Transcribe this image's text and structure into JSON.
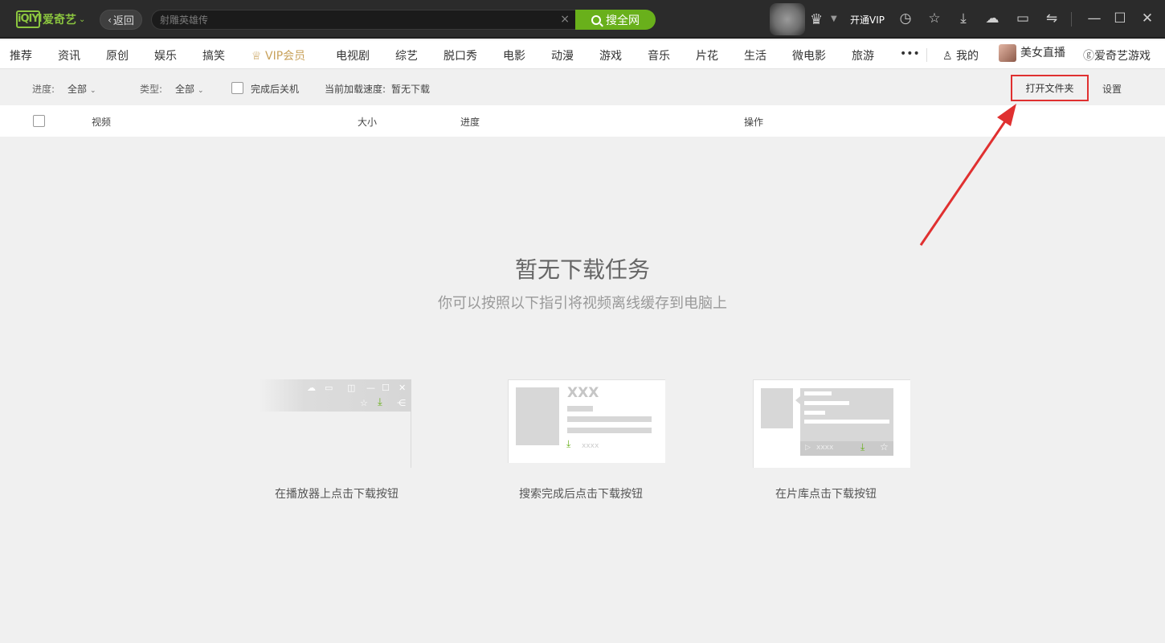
{
  "titlebar": {
    "logo_box": "iQIYI",
    "logo_text": "爱奇艺",
    "back_label": "返回",
    "search_placeholder": "射雕英雄传",
    "search_button": "搜全网",
    "vip_open": "开通VIP",
    "icons": [
      "crown-icon",
      "history-icon",
      "star-icon",
      "download-icon",
      "cloud-icon",
      "message-icon",
      "switch-icon",
      "minimize-icon",
      "maximize-icon",
      "close-icon"
    ]
  },
  "nav": {
    "items": [
      "推荐",
      "资讯",
      "原创",
      "娱乐",
      "搞笑",
      "VIP会员",
      "电视剧",
      "综艺",
      "脱口秀",
      "电影",
      "动漫",
      "游戏",
      "音乐",
      "片花",
      "生活",
      "微电影",
      "旅游"
    ],
    "more": "•••",
    "mine": "我的",
    "live": "美女直播",
    "games": "爱奇艺游戏"
  },
  "filter": {
    "progress_label": "进度:",
    "progress_value": "全部",
    "type_label": "类型:",
    "type_value": "全部",
    "shutdown_label": "完成后关机",
    "speed_label": "当前加载速度:",
    "speed_value": "暂无下载",
    "open_folder": "打开文件夹",
    "settings": "设置"
  },
  "table": {
    "headers": [
      "视频",
      "大小",
      "进度",
      "操作"
    ]
  },
  "empty": {
    "title": "暂无下载任务",
    "subtitle": "你可以按照以下指引将视频离线缓存到电脑上",
    "guides": [
      {
        "caption": "在播放器上点击下载按钮"
      },
      {
        "caption": "搜索完成后点击下载按钮",
        "placeholder": "XXX",
        "small": "xxxx"
      },
      {
        "caption": "在片库点击下载按钮",
        "small": "xxxx"
      }
    ]
  },
  "colors": {
    "brand_green": "#69b01b",
    "titlebar_bg": "#2b2b2b",
    "annotation_red": "#e03030",
    "vip_gold": "#c8a15a"
  }
}
